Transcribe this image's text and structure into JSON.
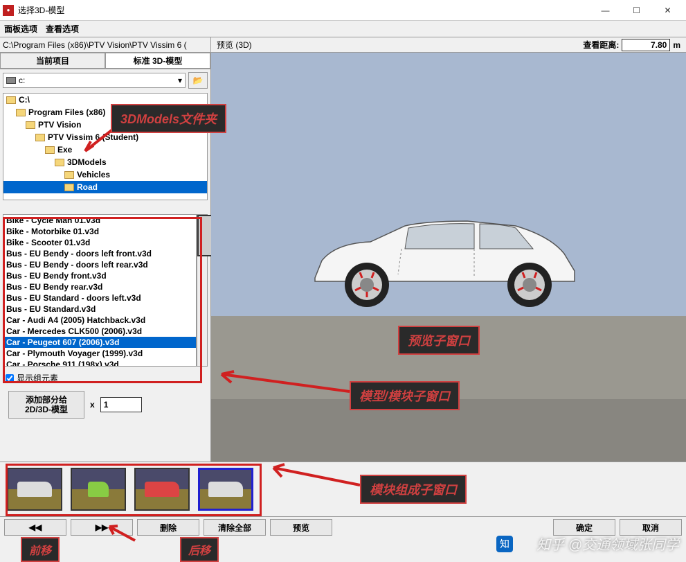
{
  "window": {
    "title": "选择3D-模型"
  },
  "menu": {
    "panel_options": "面板选项",
    "view_options": "查看选项"
  },
  "path": "C:\\Program Files (x86)\\PTV Vision\\PTV Vissim 6 (",
  "preview_label": "预览 (3D)",
  "view_distance": {
    "label": "查看距离:",
    "value": "7.80",
    "unit": "m"
  },
  "tabs": {
    "current": "当前项目",
    "standard": "标准 3D-模型"
  },
  "drive": "c:",
  "tree": [
    {
      "label": "C:\\",
      "indent": 0
    },
    {
      "label": "Program Files (x86)",
      "indent": 1
    },
    {
      "label": "PTV Vision",
      "indent": 2
    },
    {
      "label": "PTV Vissim 6 (Student)",
      "indent": 3
    },
    {
      "label": "Exe",
      "indent": 4
    },
    {
      "label": "3DModels",
      "indent": 5
    },
    {
      "label": "Vehicles",
      "indent": 6
    },
    {
      "label": "Road",
      "indent": 6,
      "selected": true
    }
  ],
  "files": [
    "Bike - Cycle Man 01.v3d",
    "Bike - Motorbike 01.v3d",
    "Bike - Scooter 01.v3d",
    "Bus - EU Bendy - doors left front.v3d",
    "Bus - EU Bendy - doors left rear.v3d",
    "Bus - EU Bendy front.v3d",
    "Bus - EU Bendy rear.v3d",
    "Bus - EU Standard - doors left.v3d",
    "Bus - EU Standard.v3d",
    "Car - Audi A4 (2005) Hatchback.v3d",
    "Car - Mercedes CLK500 (2006).v3d",
    "Car - Peugeot 607 (2006).v3d",
    "Car - Plymouth Voyager (1999).v3d",
    "Car - Porsche 911 (198x).v3d"
  ],
  "selected_file_index": 11,
  "show_elements": "显示组元素",
  "add_section": {
    "button": "添加部分给 2D/3D-模型",
    "x": "x",
    "value": "1"
  },
  "bottom_buttons": {
    "prev": "◀◀",
    "next": "▶▶",
    "delete": "删除",
    "clear_all": "清除全部",
    "preview": "预览",
    "ok": "确定",
    "cancel": "取消"
  },
  "annotations": {
    "folder": "3DModels文件夹",
    "preview_sub": "预览子窗口",
    "model_sub": "模型/模块子窗口",
    "component_sub": "模块组成子窗口",
    "move_prev": "前移",
    "move_next": "后移"
  },
  "watermark": "知乎 @交通领域张同学"
}
